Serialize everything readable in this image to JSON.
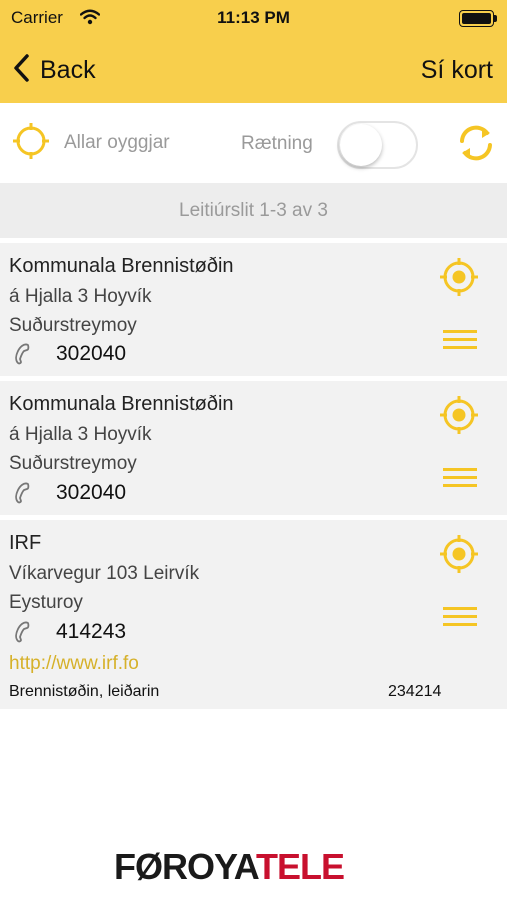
{
  "status_bar": {
    "carrier": "Carrier",
    "time": "11:13 PM",
    "wifi_icon": "wifi-icon",
    "battery_icon": "battery-icon"
  },
  "nav": {
    "back_label": "Back",
    "map_label": "Sí kort",
    "back_icon": "chevron-left-icon"
  },
  "filters": {
    "islands_label": "Allar oyggjar",
    "islands_icon": "locate-icon",
    "sort_label": "Rætning",
    "sort_on": false,
    "refresh_icon": "refresh-icon"
  },
  "results": {
    "summary": "Leitiúrslit 1-3 av 3"
  },
  "items": [
    {
      "name": "Kommunala Brennistøðin",
      "address": "á Hjalla 3 Hoyvík",
      "region": "Suðurstreymoy",
      "phone": "302040"
    },
    {
      "name": "Kommunala Brennistøðin",
      "address": "á Hjalla 3 Hoyvík",
      "region": "Suðurstreymoy",
      "phone": "302040"
    },
    {
      "name": "IRF",
      "address": "Víkarvegur 103 Leirvík",
      "region": "Eysturoy",
      "phone": "414243",
      "link": "http://www.irf.fo",
      "category": "Brennistøðin, leiðarin",
      "category_number": "234214"
    }
  ],
  "brand": {
    "logo_text": "FØROYATELE"
  },
  "colors": {
    "accent": "#f8cf4c",
    "icon_yellow": "#f5c524",
    "link": "#d6b12a",
    "row_bg": "#f2f2f2",
    "muted_text": "#9a9a9a"
  }
}
